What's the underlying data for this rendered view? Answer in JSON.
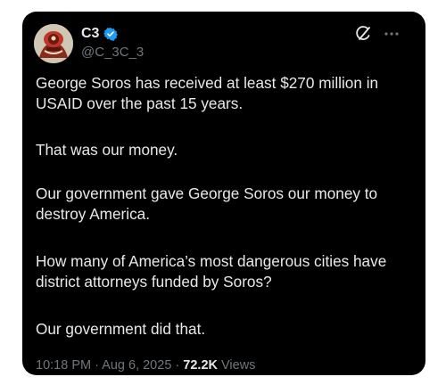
{
  "author": {
    "display_name": "C3",
    "handle": "@C_3C_3",
    "verified": true
  },
  "icons": {
    "avatar": "avatar-image",
    "verified": "verified-badge-icon",
    "grok": "grok-icon",
    "more": "more-options-icon"
  },
  "colors": {
    "background": "#000000",
    "text": "#e7e9ea",
    "secondary_text": "#71767b",
    "verified_blue": "#1d9bf0"
  },
  "tweet": {
    "paragraphs": [
      "George Soros has received at least $270 million in\nUSAID over the past 15 years.",
      "That was our money.",
      "Our government gave George Soros our money to\ndestroy America.",
      "How many of America’s most dangerous cities have\ndistrict attorneys funded by Soros?",
      "Our government did that."
    ]
  },
  "meta": {
    "time": "10:18 PM",
    "separator1": " · ",
    "date": "Aug 6, 2025",
    "separator2": " · ",
    "views_count": "72.2K",
    "views_label": " Views"
  }
}
